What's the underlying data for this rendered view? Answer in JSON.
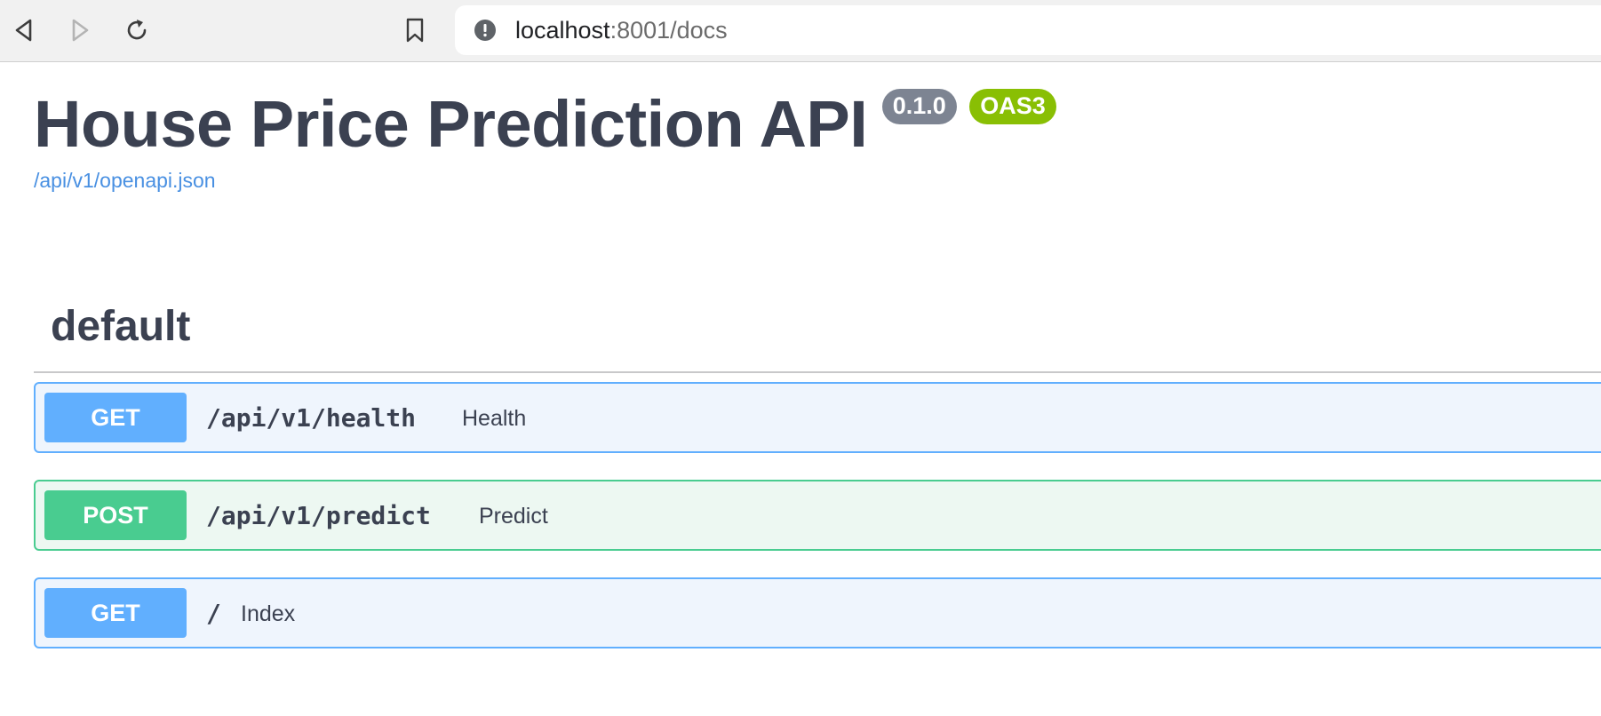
{
  "browser": {
    "url_host": "localhost",
    "url_rest": ":8001/docs",
    "icons": {
      "back": "back-arrow-icon",
      "forward": "forward-arrow-icon",
      "reload": "reload-icon",
      "bookmark": "bookmark-icon",
      "site_info": "info-icon"
    }
  },
  "info": {
    "title": "House Price Prediction API",
    "version": "0.1.0",
    "oas_badge": "OAS3",
    "spec_link": "/api/v1/openapi.json"
  },
  "section": {
    "name": "default"
  },
  "operations": [
    {
      "method": "GET",
      "path": "/api/v1/health",
      "summary": "Health"
    },
    {
      "method": "POST",
      "path": "/api/v1/predict",
      "summary": "Predict"
    },
    {
      "method": "GET",
      "path": "/",
      "summary": "Index"
    }
  ],
  "colors": {
    "get": "#61affe",
    "post": "#49cc90",
    "title": "#3b4151",
    "link": "#4990e2",
    "version_badge": "#7d8492",
    "oas_badge": "#89bf04"
  }
}
